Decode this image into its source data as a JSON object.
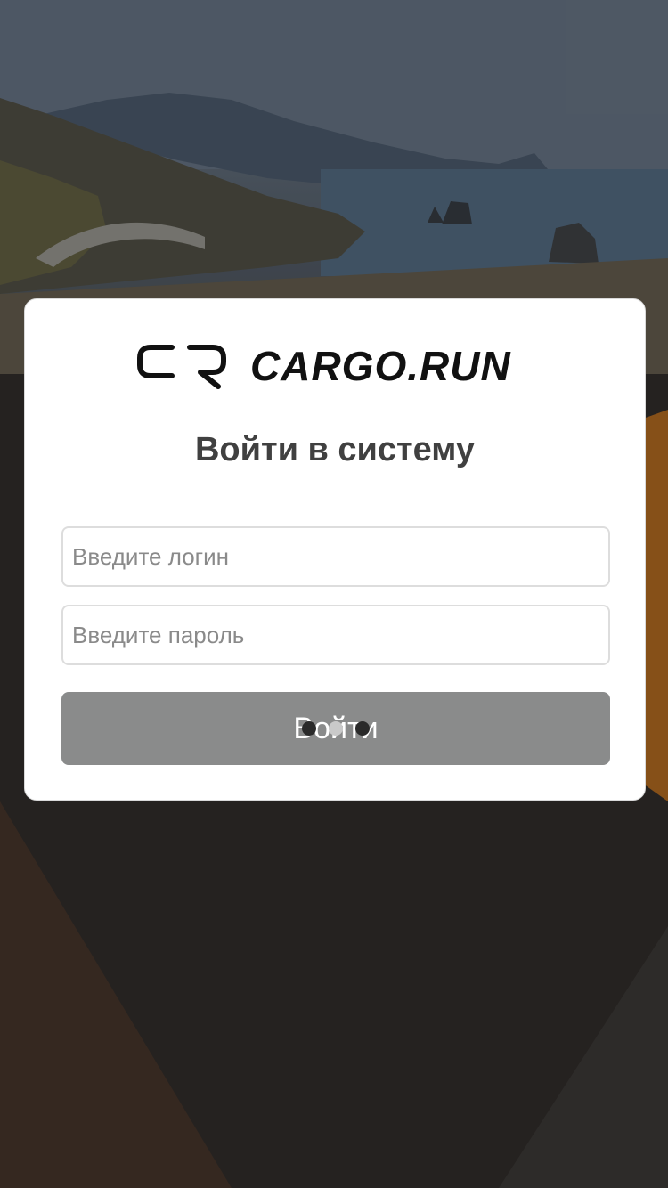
{
  "background": {
    "description_icon": "coastal-road-photo"
  },
  "brand": {
    "logo_text": "CARGO.RUN",
    "logo_mark_icon": "cr-logo-icon"
  },
  "login_form": {
    "title": "Войти в систему",
    "login_placeholder": "Введите логин",
    "password_placeholder": "Введите пароль",
    "submit_label": "Войти",
    "submit_state": "loading"
  },
  "colors": {
    "button_bg": "#8a8b8b",
    "title_text": "#404040",
    "card_bg": "#ffffff"
  }
}
